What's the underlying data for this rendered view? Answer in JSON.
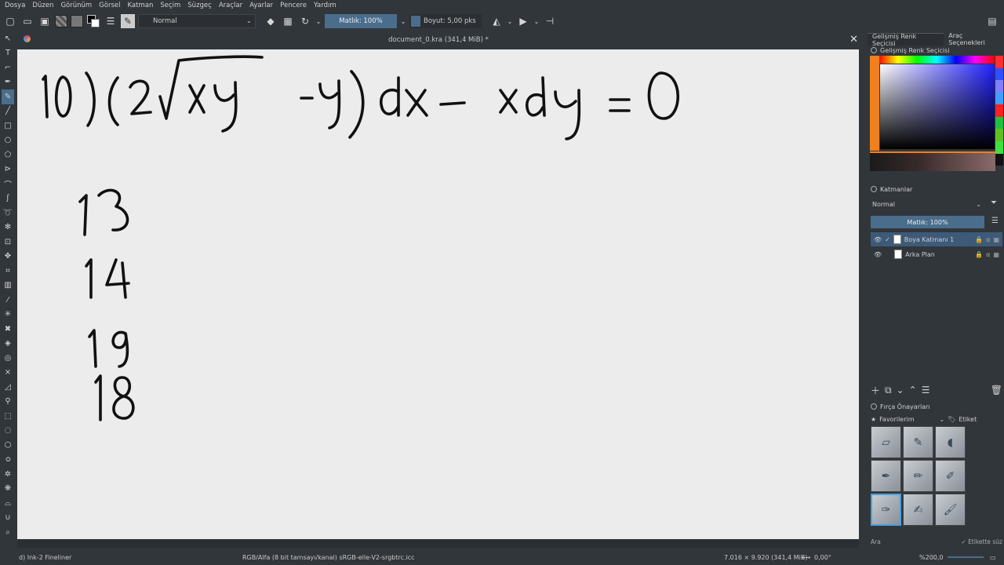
{
  "menu": [
    "Dosya",
    "Düzen",
    "Görünüm",
    "Görsel",
    "Katman",
    "Seçim",
    "Süzgeç",
    "Araçlar",
    "Ayarlar",
    "Pencere",
    "Yardım"
  ],
  "toolbar": {
    "blend_mode": "Normal",
    "opacity": "Matlık: 100%",
    "size": "Boyut: 5,00 pks"
  },
  "document": {
    "tab_title": "document_0.kra (341,4 MiB) *"
  },
  "canvas_content": {
    "equation": "10) (2√xy −y) dx − xdy = 0",
    "numbers": [
      "13",
      "14",
      "19",
      "18"
    ]
  },
  "status": {
    "brush_name": "d) Ink-2 Fineliner",
    "color_profile": "RGB/Alfa (8 bit tamsayı/kanal) sRGB-elle-V2-srgbtrc.icc",
    "dimensions": "7.016 × 9.920 (341,4 MiB)",
    "rotation": "0,00°",
    "zoom": "%200,0"
  },
  "dock": {
    "tab_color_selector": "Gelişmiş Renk Seçicisi",
    "tab_tool_options": "Araç Seçenekleri",
    "color_panel_title": "Gelişmiş Renk Seçicisi",
    "layers_title": "Katmanlar",
    "layers_blend": "Normal",
    "layers_opacity": "Matlık:  100%",
    "layers": [
      {
        "name": "Boya Katmanı 1",
        "selected": true
      },
      {
        "name": "Arka Plan",
        "selected": false
      }
    ],
    "brush_presets_title": "Fırça Önayarları",
    "favorites": "Favorilerim",
    "tag_label": "Etiket",
    "search_placeholder": "Ara",
    "filter_tag": "Etikette süz"
  },
  "colors": {
    "accent": "#4a6d8c",
    "foreground_orange": "#f0801c",
    "canvas_bg": "#ececec",
    "ui_bg": "#31363b"
  }
}
